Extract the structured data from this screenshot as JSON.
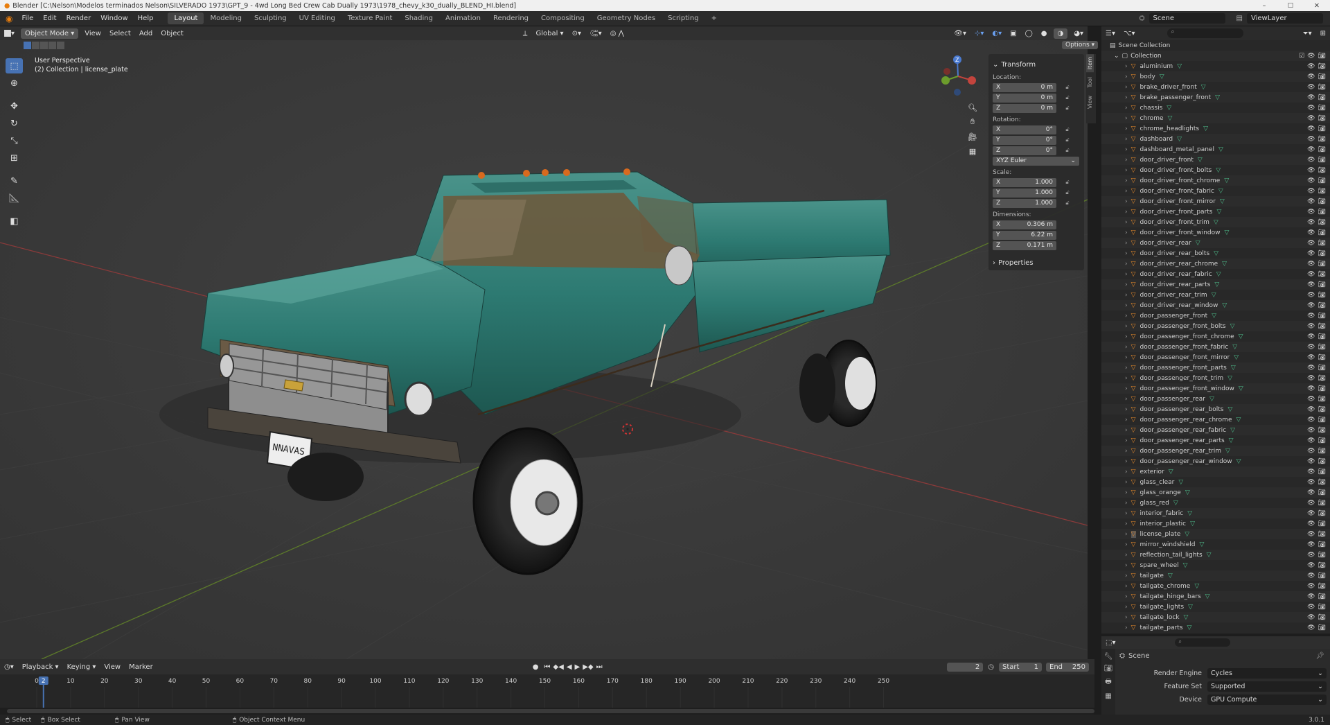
{
  "window": {
    "title": "Blender [C:\\Nelson\\Modelos terminados Nelson\\SILVERADO 1973\\GPT_9 - 4wd Long Bed Crew Cab Dually 1973\\1978_chevy_k30_dually_BLEND_HI.blend]",
    "min": "–",
    "max": "☐",
    "close": "✕"
  },
  "menu": [
    "File",
    "Edit",
    "Render",
    "Window",
    "Help"
  ],
  "workspaces": [
    "Layout",
    "Modeling",
    "Sculpting",
    "UV Editing",
    "Texture Paint",
    "Shading",
    "Animation",
    "Rendering",
    "Compositing",
    "Geometry Nodes",
    "Scripting"
  ],
  "workspace_add": "+",
  "top_right": {
    "scene": "Scene",
    "view_layer": "ViewLayer"
  },
  "viewport": {
    "mode": "Object Mode",
    "menus": [
      "View",
      "Select",
      "Add",
      "Object"
    ],
    "orientation": "Global",
    "options": "Options",
    "overlay_title": "User Perspective",
    "overlay_sub": "(2) Collection | license_plate",
    "plate_text": "NNAVAS",
    "gizmo": {
      "z": "Z",
      "y": "Y",
      "x": "X"
    }
  },
  "npanel": {
    "tabs": [
      "Item",
      "Tool",
      "View"
    ],
    "transform_label": "Transform",
    "location_label": "Location:",
    "location": [
      {
        "axis": "X",
        "value": "0 m"
      },
      {
        "axis": "Y",
        "value": "0 m"
      },
      {
        "axis": "Z",
        "value": "0 m"
      }
    ],
    "rotation_label": "Rotation:",
    "rotation": [
      {
        "axis": "X",
        "value": "0°"
      },
      {
        "axis": "Y",
        "value": "0°"
      },
      {
        "axis": "Z",
        "value": "0°"
      }
    ],
    "rotation_mode": "XYZ Euler",
    "scale_label": "Scale:",
    "scale": [
      {
        "axis": "X",
        "value": "1.000"
      },
      {
        "axis": "Y",
        "value": "1.000"
      },
      {
        "axis": "Z",
        "value": "1.000"
      }
    ],
    "dimensions_label": "Dimensions:",
    "dimensions": [
      {
        "axis": "X",
        "value": "0.306 m"
      },
      {
        "axis": "Y",
        "value": "6.22 m"
      },
      {
        "axis": "Z",
        "value": "0.171 m"
      }
    ],
    "properties_label": "Properties"
  },
  "outliner": {
    "root": "Scene Collection",
    "collection": "Collection",
    "items": [
      "aluminium",
      "body",
      "brake_driver_front",
      "brake_passenger_front",
      "chassis",
      "chrome",
      "chrome_headlights",
      "dashboard",
      "dashboard_metal_panel",
      "door_driver_front",
      "door_driver_front_bolts",
      "door_driver_front_chrome",
      "door_driver_front_fabric",
      "door_driver_front_mirror",
      "door_driver_front_parts",
      "door_driver_front_trim",
      "door_driver_front_window",
      "door_driver_rear",
      "door_driver_rear_bolts",
      "door_driver_rear_chrome",
      "door_driver_rear_fabric",
      "door_driver_rear_parts",
      "door_driver_rear_trim",
      "door_driver_rear_window",
      "door_passenger_front",
      "door_passenger_front_bolts",
      "door_passenger_front_chrome",
      "door_passenger_front_fabric",
      "door_passenger_front_mirror",
      "door_passenger_front_parts",
      "door_passenger_front_trim",
      "door_passenger_front_window",
      "door_passenger_rear",
      "door_passenger_rear_bolts",
      "door_passenger_rear_chrome",
      "door_passenger_rear_fabric",
      "door_passenger_rear_parts",
      "door_passenger_rear_trim",
      "door_passenger_rear_window",
      "exterior",
      "glass_clear",
      "glass_orange",
      "glass_red",
      "interior_fabric",
      "interior_plastic",
      "license_plate",
      "mirror_windshield",
      "reflection_tail_lights",
      "spare_wheel",
      "tailgate",
      "tailgate_chrome",
      "tailgate_hinge_bars",
      "tailgate_lights",
      "tailgate_lock",
      "tailgate_parts"
    ],
    "selected": "license_plate"
  },
  "properties": {
    "scene": "Scene",
    "rows": [
      {
        "label": "Render Engine",
        "value": "Cycles"
      },
      {
        "label": "Feature Set",
        "value": "Supported"
      },
      {
        "label": "Device",
        "value": "GPU Compute"
      }
    ]
  },
  "timeline": {
    "menus": [
      "Playback",
      "Keying",
      "View",
      "Marker"
    ],
    "current": "2",
    "start_label": "Start",
    "start": "1",
    "end_label": "End",
    "end": "250",
    "ticks": [
      "0",
      "10",
      "20",
      "30",
      "40",
      "50",
      "60",
      "70",
      "80",
      "90",
      "100",
      "110",
      "120",
      "130",
      "140",
      "150",
      "160",
      "170",
      "180",
      "190",
      "200",
      "210",
      "220",
      "230",
      "240",
      "250"
    ],
    "current_frame": 2
  },
  "status": {
    "select": "Select",
    "box_select": "Box Select",
    "pan_view": "Pan View",
    "context_menu": "Object Context Menu",
    "version": "3.0.1"
  },
  "colors": {
    "accent": "#4772b3",
    "selected_frame": "#4772b3",
    "car_paint": "#2d7a72"
  }
}
